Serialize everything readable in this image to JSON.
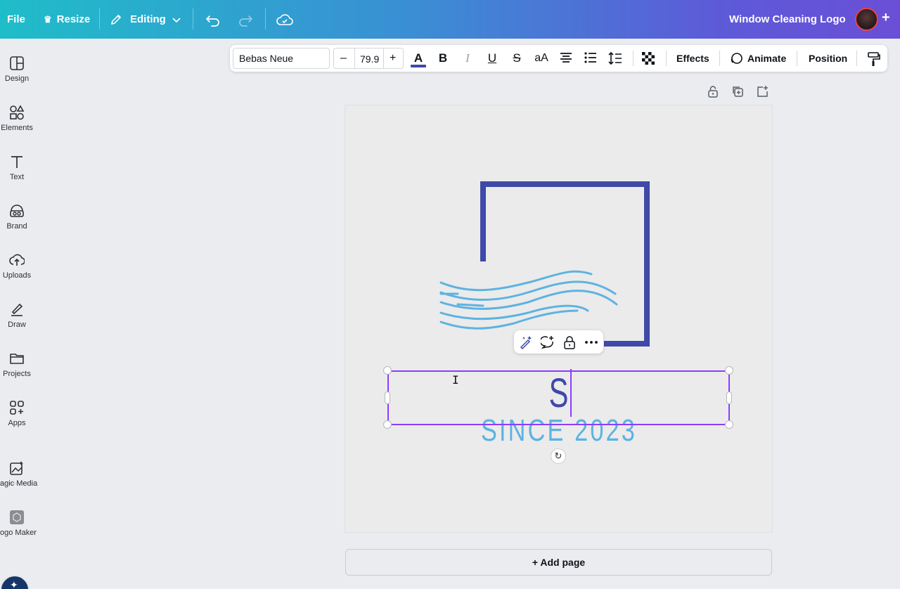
{
  "topbar": {
    "file": "File",
    "resize": "Resize",
    "editing": "Editing",
    "title": "Window Cleaning Logo"
  },
  "rail": [
    {
      "label": "Design",
      "icon": "design-icon"
    },
    {
      "label": "Elements",
      "icon": "elements-icon"
    },
    {
      "label": "Text",
      "icon": "text-icon"
    },
    {
      "label": "Brand",
      "icon": "brand-icon"
    },
    {
      "label": "Uploads",
      "icon": "uploads-icon"
    },
    {
      "label": "Draw",
      "icon": "draw-icon"
    },
    {
      "label": "Projects",
      "icon": "projects-icon"
    },
    {
      "label": "Apps",
      "icon": "apps-icon"
    },
    {
      "label": "agic Media",
      "icon": "magic-media-icon"
    },
    {
      "label": "ogo Maker",
      "icon": "logo-maker-icon"
    }
  ],
  "toolbar": {
    "font": "Bebas Neue",
    "size_minus": "–",
    "size": "79.9",
    "size_plus": "+",
    "effects": "Effects",
    "animate": "Animate",
    "position": "Position"
  },
  "canvas": {
    "selected_text": "S",
    "tagline": "SINCE 2023",
    "frame_color": "#3e49a8",
    "wave_color": "#5db3e1"
  },
  "add_page": "+ Add page",
  "colors": {
    "selection": "#8b3dff",
    "text_color_underline": "#3e49a8"
  }
}
